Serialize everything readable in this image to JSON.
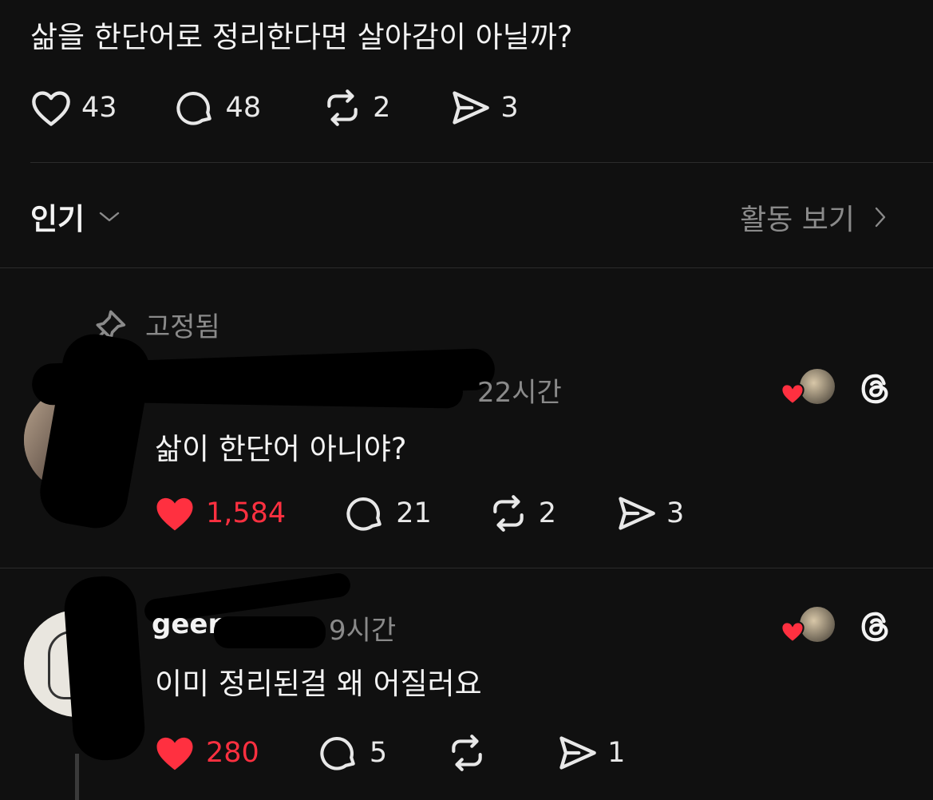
{
  "post": {
    "text": "삶을 한단어로 정리한다면 살아감이 아닐까?",
    "likes": "43",
    "replies": "48",
    "reposts": "2",
    "shares": "3"
  },
  "sort": {
    "label": "인기"
  },
  "activity": {
    "label": "활동 보기"
  },
  "pinned": {
    "label": "고정됨"
  },
  "comments": [
    {
      "username": "",
      "time": "22시간",
      "text": "삶이 한단어 아니야?",
      "likes": "1,584",
      "replies": "21",
      "reposts": "2",
      "shares": "3"
    },
    {
      "username": "geen",
      "time": "9시간",
      "text": "이미 정리된걸 왜 어질러요",
      "likes": "280",
      "replies": "5",
      "reposts": "",
      "shares": "1"
    }
  ],
  "colors": {
    "background": "#101010",
    "like_red": "#ff3040",
    "muted": "#8a8a8a"
  }
}
